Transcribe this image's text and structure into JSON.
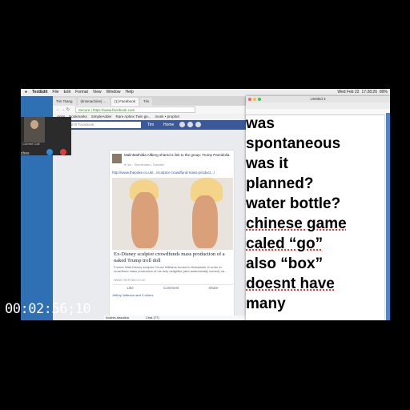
{
  "menubar": {
    "apple": "",
    "items": [
      "TextEdit",
      "File",
      "Edit",
      "Format",
      "View",
      "Window",
      "Help"
    ],
    "right": [
      "Wed Feb 22",
      "17:28:26",
      "89%"
    ]
  },
  "browser": {
    "tabs": [
      "Tim Tsang",
      "(tinsmachine) ...",
      "(1) Facebook",
      "Tim"
    ],
    "url": "Secure | https://www.facebook.com",
    "bookmarks": [
      "Apps",
      "Bookmarks",
      "SimpleAdder",
      "Rare Aphex Twin ge...",
      "monk • prophet"
    ],
    "facebook": {
      "search_placeholder": "Search Facebook",
      "user": "Tim",
      "home": "Home"
    },
    "post": {
      "header": "MalinMathilda Allberg shared a link to the group: Trump Pareidolia.",
      "meta": "8 hrs · Simrishamn, Sweden",
      "link": "http://www.thepoke.co.uk/.../sculptor-crowdfund-mass-product.../",
      "card_title": "Ex-Disney sculptor crowdfunds mass production of a naked Trump troll doll",
      "card_desc": "Former Walt Disney sculptor Chuck Williams turned to Kickstarter in order to crowdfund mass production of his truly delightful (and anatomically correct) na...",
      "card_source": "WWW.THEPOKE.CO.UK",
      "actions": [
        "Like",
        "Comment",
        "Share"
      ],
      "likes": "Jeffrey Vallence and 3 others"
    },
    "chat": {
      "contact": "Andrés Aasolina",
      "chat_label": "Chat (77)"
    }
  },
  "call_window": {
    "label": "Current Call",
    "side_label": "ches"
  },
  "textedit": {
    "title": "Untitled 3",
    "lines": [
      {
        "text": "was",
        "misspelled": false
      },
      {
        "text": "spontaneous",
        "misspelled": false
      },
      {
        "text": "was it",
        "misspelled": false
      },
      {
        "text": "planned?",
        "misspelled": false
      },
      {
        "text": "water bottle?",
        "misspelled": false
      },
      {
        "text": "chinese game",
        "misspelled": true
      },
      {
        "text": "caled “go”",
        "misspelled": true
      },
      {
        "text": "also “box”",
        "misspelled": false
      },
      {
        "text": "doesnt have",
        "misspelled": true
      },
      {
        "text": "many",
        "misspelled": false
      }
    ]
  },
  "timecode": "00:02:56;10",
  "colors": {
    "facebook_blue": "#3b5998",
    "desktop_blue": "#2f6fb4",
    "misspell_red": "#e33333"
  }
}
